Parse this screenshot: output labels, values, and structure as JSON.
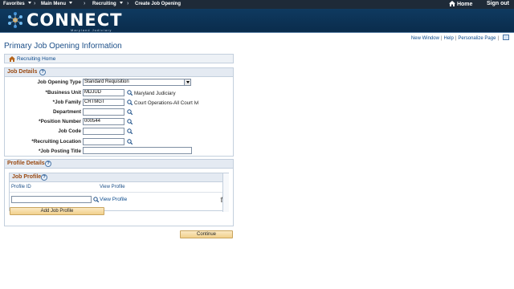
{
  "topnav": {
    "favorites": "Favorites",
    "main_menu": "Main Menu",
    "recruiting": "Recruiting",
    "current": "Create Job Opening",
    "home": "Home",
    "signout": "Sign out"
  },
  "banner": {
    "logo_text": "CONNECT",
    "logo_sub": "Maryland Judiciary"
  },
  "utility": {
    "new_window": "New Window",
    "help": "Help",
    "personalize": "Personalize Page"
  },
  "page_title": "Primary Job Opening Information",
  "breadcrumb": {
    "recruiting_home": "Recruiting Home"
  },
  "job_details": {
    "header": "Job Details",
    "job_opening_type": {
      "label": "Job Opening Type",
      "value": "Standard Requisition"
    },
    "business_unit": {
      "label": "*Business Unit",
      "value": "MDJUD",
      "description": "Maryland Judiciary"
    },
    "job_family": {
      "label": "*Job Family",
      "value": "CRTMGT",
      "description": "Court Operations-All Court lvl"
    },
    "department": {
      "label": "Department",
      "value": ""
    },
    "position_number": {
      "label": "*Position Number",
      "value": "000544"
    },
    "job_code": {
      "label": "Job Code",
      "value": ""
    },
    "recruiting_location": {
      "label": "*Recruiting Location",
      "value": ""
    },
    "job_posting_title": {
      "label": "*Job Posting Title",
      "value": ""
    }
  },
  "profile_details": {
    "header": "Profile Details",
    "job_profile": {
      "header": "Job Profile",
      "col_profile_id": "Profile ID",
      "col_view_profile": "View Profile",
      "row_profile_id": "",
      "row_view_profile": "View Profile",
      "add_button": "Add Job Profile"
    }
  },
  "continue_button": "Continue",
  "help_glyph": "?"
}
